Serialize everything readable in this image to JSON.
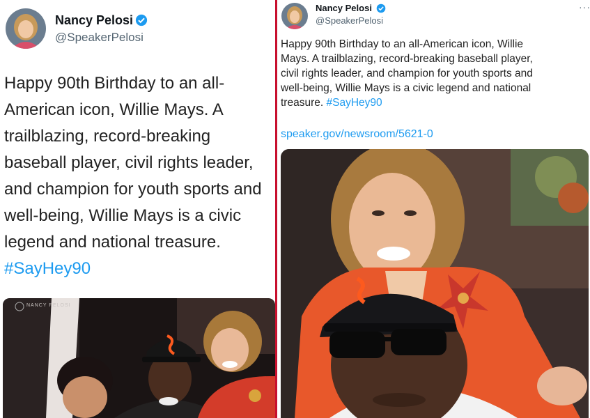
{
  "left_tweet": {
    "author_name": "Nancy Pelosi",
    "author_handle": "@SpeakerPelosi",
    "verified": true,
    "text_lines": [
      "Happy 90th Birthday to an all-",
      "American icon, Willie Mays. A",
      "trailblazing, record-breaking",
      "baseball player, civil rights leader,",
      "and champion for youth sports and",
      "well-being, Willie Mays is a civic",
      "legend and national treasure."
    ],
    "hashtag": "#SayHey90",
    "photo_watermark": "NANCY PELOSI"
  },
  "right_tweet": {
    "author_name": "Nancy Pelosi",
    "author_handle": "@SpeakerPelosi",
    "verified": true,
    "text_lines": [
      "Happy 90th Birthday to an all-American icon, Willie",
      "Mays. A trailblazing, record-breaking baseball player,",
      "civil rights leader, and champion for youth sports and",
      "well-being, Willie Mays is a civic legend and national",
      "treasure."
    ],
    "hashtag": "#SayHey90",
    "link": "speaker.gov/newsroom/5621-0",
    "more_icon": "more-horizontal-icon"
  },
  "colors": {
    "hashtag_blue": "#1d9bf0",
    "verified_blue": "#1d9bf0",
    "divider_red": "#c8102e",
    "jacket_orange": "#e8582b",
    "giants_orange": "#fd5a1e"
  }
}
